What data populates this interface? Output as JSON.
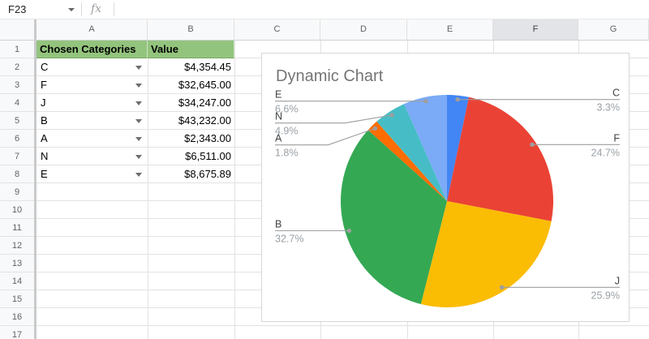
{
  "toolbar": {
    "name_box_value": "F23",
    "formula_icon": "fx",
    "formula_value": ""
  },
  "grid": {
    "column_labels": [
      "A",
      "B",
      "C",
      "D",
      "E",
      "F",
      "G"
    ],
    "selected_column": "F",
    "row_numbers": [
      1,
      2,
      3,
      4,
      5,
      6,
      7,
      8,
      9,
      10,
      11,
      12,
      13,
      14,
      15,
      16,
      17
    ]
  },
  "sheet": {
    "headers": [
      "Chosen Categories",
      "Value"
    ],
    "header_fill": "#93C47D",
    "rows": [
      {
        "category": "C",
        "value": "$4,354.45"
      },
      {
        "category": "F",
        "value": "$32,645.00"
      },
      {
        "category": "J",
        "value": "$34,247.00"
      },
      {
        "category": "B",
        "value": "$43,232.00"
      },
      {
        "category": "A",
        "value": "$2,343.00"
      },
      {
        "category": "N",
        "value": "$6,511.00"
      },
      {
        "category": "E",
        "value": "$8,675.89"
      }
    ]
  },
  "chart_data": {
    "type": "pie",
    "title": "Dynamic Chart",
    "legend_position": "none",
    "labels_style": "outside-callout",
    "start_angle_deg": 0,
    "direction": "clockwise",
    "slices": [
      {
        "label": "C",
        "pct": 3.3,
        "color": "#4285F4"
      },
      {
        "label": "F",
        "pct": 24.7,
        "color": "#EA4335"
      },
      {
        "label": "J",
        "pct": 25.9,
        "color": "#FBBC04"
      },
      {
        "label": "B",
        "pct": 32.7,
        "color": "#34A853"
      },
      {
        "label": "A",
        "pct": 1.8,
        "color": "#FF6D01"
      },
      {
        "label": "N",
        "pct": 4.9,
        "color": "#46BDC6"
      },
      {
        "label": "E",
        "pct": 6.6,
        "color": "#7BAAF7"
      }
    ]
  }
}
